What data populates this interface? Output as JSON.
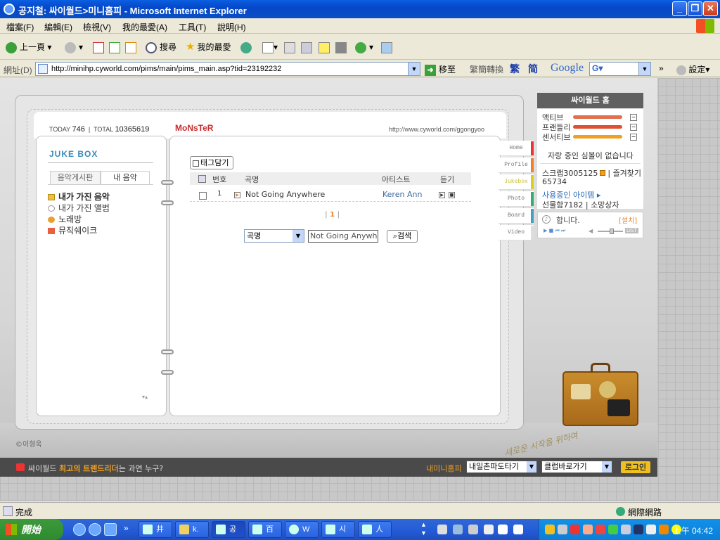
{
  "window": {
    "title": "공지철: 싸이월드>미니홈피 - Microsoft Internet Explorer"
  },
  "menu": [
    "檔案(F)",
    "編輯(E)",
    "檢視(V)",
    "我的最愛(A)",
    "工具(T)",
    "說明(H)"
  ],
  "toolbar": {
    "back": "上一頁",
    "search": "搜尋",
    "favorites": "我的最愛"
  },
  "address": {
    "label": "網址(D)",
    "url": "http://minihp.cyworld.com/pims/main/pims_main.asp?tid=23192232",
    "go": "移至",
    "convert": "繁簡轉換",
    "trad": "繁",
    "simp": "简",
    "google": "Google",
    "settings": "設定"
  },
  "minihompy": {
    "today_label": "TODAY",
    "today": "746",
    "total_label": "TOTAL",
    "total": "10365619",
    "title": "MoNsTeR",
    "url": "http://www.cyworld.com/ggongyoo",
    "copyright": "©이형욱",
    "slogan": "새로운 시작을 위하여"
  },
  "jukebox": {
    "title": "JUKE BOX",
    "tabs": [
      "음악게시판",
      "내 음악"
    ],
    "items": [
      "내가 가진 음악",
      "내가 가진 앨범",
      "노래방",
      "뮤직쉐이크"
    ]
  },
  "music": {
    "tag_button": "태그담기",
    "columns": [
      "번호",
      "곡명",
      "아티스트",
      "듣기"
    ],
    "rows": [
      {
        "no": "1",
        "title": "Not Going Anywhere",
        "artist": "Keren Ann"
      }
    ],
    "page": "1",
    "search_select": "곡명",
    "search_value": "Not Going Anywhere",
    "search_button": "검색"
  },
  "side_tabs": [
    "Home",
    "Profile",
    "Jukebox",
    "Photo",
    "Board",
    "Video"
  ],
  "cyworld_panel": {
    "header": "싸이월드 홈",
    "meters": [
      {
        "label": "액티브",
        "color": "#e07050"
      },
      {
        "label": "프랜들리",
        "color": "#e05030"
      },
      {
        "label": "센서티브",
        "color": "#f0a020"
      }
    ],
    "symbol_text": "자랑 중인 심볼이 없습니다",
    "scrap": "스크랩3005125",
    "favorite": "즐겨찾기",
    "favorite_count": "65734",
    "items_link": "사용중인 아이템",
    "gift": "선물함7182",
    "wish": "소망상자",
    "player_text": "합니다.",
    "install": "[설치]"
  },
  "bottom_bar": {
    "notice_prefix": "싸이월드 ",
    "notice_bold": "최고의 트렌드리더",
    "notice_suffix": "는 과연 누구?",
    "mini_label": "내미니홈피",
    "select1": "내일촌파도타기",
    "select2": "클럽바로가기",
    "login": "로그인"
  },
  "status": {
    "text": "完成",
    "zone": "網際網路"
  },
  "taskbar": {
    "start": "開始",
    "buttons": [
      "井",
      "k.",
      "공",
      "百",
      "W",
      "시",
      "人"
    ],
    "clock": "上午 04:42"
  }
}
